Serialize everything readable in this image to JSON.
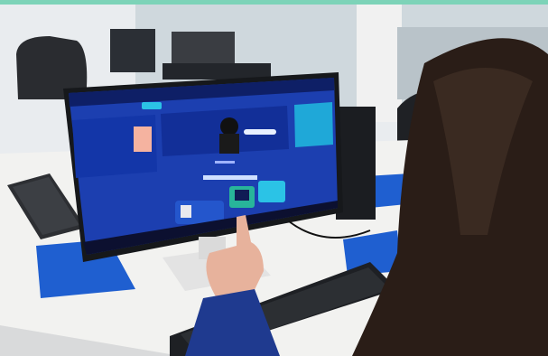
{
  "photo": {
    "screen": {
      "portal_logo": "",
      "hero": [
        {
          "title": "",
          "subtitle": ""
        },
        {
          "title": "",
          "subtitle": ""
        },
        {
          "title": "",
          "subtitle": ""
        }
      ],
      "section_heading": "",
      "cards": [
        {
          "label": ""
        },
        {
          "label": ""
        },
        {
          "label": ""
        }
      ]
    },
    "colors": {
      "portal_blue": "#1c3fb0",
      "portal_dark": "#0e1f66",
      "accent_cyan": "#2bc3e6",
      "desk_white": "#f2f2f0",
      "mousepad_blue": "#1f5fd0",
      "top_band": "#7dd3b8"
    }
  }
}
